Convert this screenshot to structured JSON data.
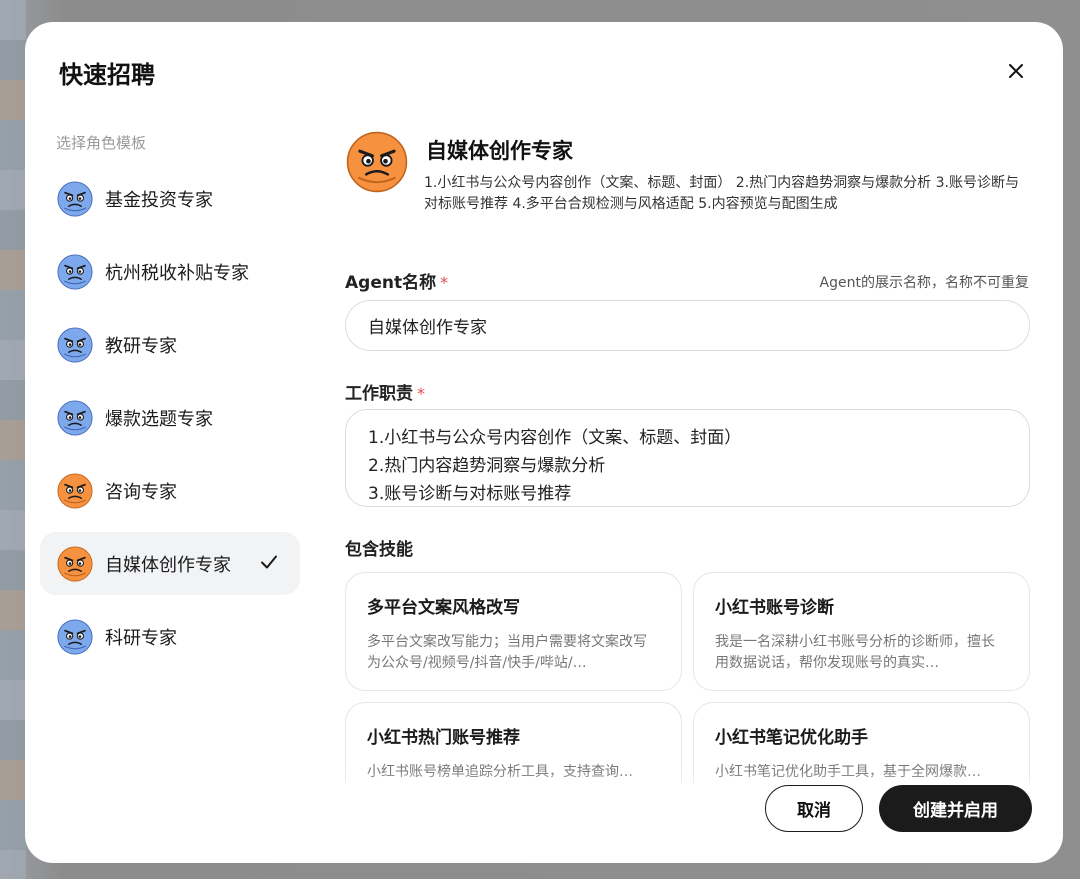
{
  "modal": {
    "title": "快速招聘"
  },
  "sidebar": {
    "heading": "选择角色模板",
    "items": [
      {
        "label": "基金投资专家",
        "avatar": "blue"
      },
      {
        "label": "杭州税收补贴专家",
        "avatar": "blue"
      },
      {
        "label": "教研专家",
        "avatar": "blue"
      },
      {
        "label": "爆款选题专家",
        "avatar": "blue"
      },
      {
        "label": "咨询专家",
        "avatar": "orange"
      },
      {
        "label": "自媒体创作专家",
        "avatar": "orange",
        "selected": true
      },
      {
        "label": "科研专家",
        "avatar": "blue"
      }
    ]
  },
  "agent": {
    "name": "自媒体创作专家",
    "description": "1.小红书与公众号内容创作（文案、标题、封面） 2.热门内容趋势洞察与爆款分析 3.账号诊断与对标账号推荐 4.多平台合规检测与风格适配 5.内容预览与配图生成"
  },
  "form": {
    "name_label": "Agent名称",
    "required_mark": "*",
    "name_hint": "Agent的展示名称，名称不可重复",
    "name_value": "自媒体创作专家",
    "duty_label": "工作职责",
    "duty_lines": [
      "1.小红书与公众号内容创作（文案、标题、封面）",
      "2.热门内容趋势洞察与爆款分析",
      "3.账号诊断与对标账号推荐"
    ],
    "skills_label": "包含技能"
  },
  "skills": [
    {
      "title": "多平台文案风格改写",
      "desc": "多平台文案改写能力；当用户需要将文案改写为公众号/视频号/抖音/快手/哔站/…"
    },
    {
      "title": "小红书账号诊断",
      "desc": "我是一名深耕小红书账号分析的诊断师，擅长用数据说话，帮你发现账号的真实…"
    },
    {
      "title": "小红书热门账号推荐",
      "desc": "小红书账号榜单追踪分析工具，支持查询…"
    },
    {
      "title": "小红书笔记优化助手",
      "desc": "小红书笔记优化助手工具，基于全网爆款…"
    }
  ],
  "footer": {
    "cancel_label": "取消",
    "create_label": "创建并启用"
  },
  "colors": {
    "accent": "#1b1b1b",
    "required": "#e24b4b",
    "selected_bg": "#f2f3f5",
    "avatar_blue": "#7ea8ec",
    "avatar_orange": "#f5913f"
  }
}
